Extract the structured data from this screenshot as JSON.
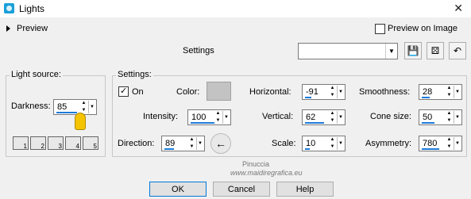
{
  "window": {
    "title": "Lights",
    "close_glyph": "✕"
  },
  "preview": {
    "label": "Preview",
    "preview_on_image_label": "Preview on Image",
    "preview_on_image_checked": false
  },
  "presets": {
    "settings_label": "Settings",
    "value": ""
  },
  "light_source": {
    "title": "Light source:",
    "darkness_label": "Darkness:",
    "darkness_value": "85",
    "preset_icons": [
      "1",
      "2",
      "3",
      "4",
      "5"
    ]
  },
  "settings": {
    "title": "Settings:",
    "on_label": "On",
    "on_checked": true,
    "color_label": "Color:",
    "color_value": "#c3c3c3",
    "intensity_label": "Intensity:",
    "intensity_value": "100",
    "direction_label": "Direction:",
    "direction_value": "89",
    "horizontal_label": "Horizontal:",
    "horizontal_value": "-91",
    "vertical_label": "Vertical:",
    "vertical_value": "62",
    "scale_label": "Scale:",
    "scale_value": "10",
    "smoothness_label": "Smoothness:",
    "smoothness_value": "28",
    "cone_size_label": "Cone size:",
    "cone_size_value": "50",
    "asymmetry_label": "Asymmetry:",
    "asymmetry_value": "780"
  },
  "watermark": {
    "brand": "Pinuccia",
    "url": "www.maidiregrafica.eu"
  },
  "buttons": {
    "ok": "OK",
    "cancel": "Cancel",
    "help": "Help"
  }
}
